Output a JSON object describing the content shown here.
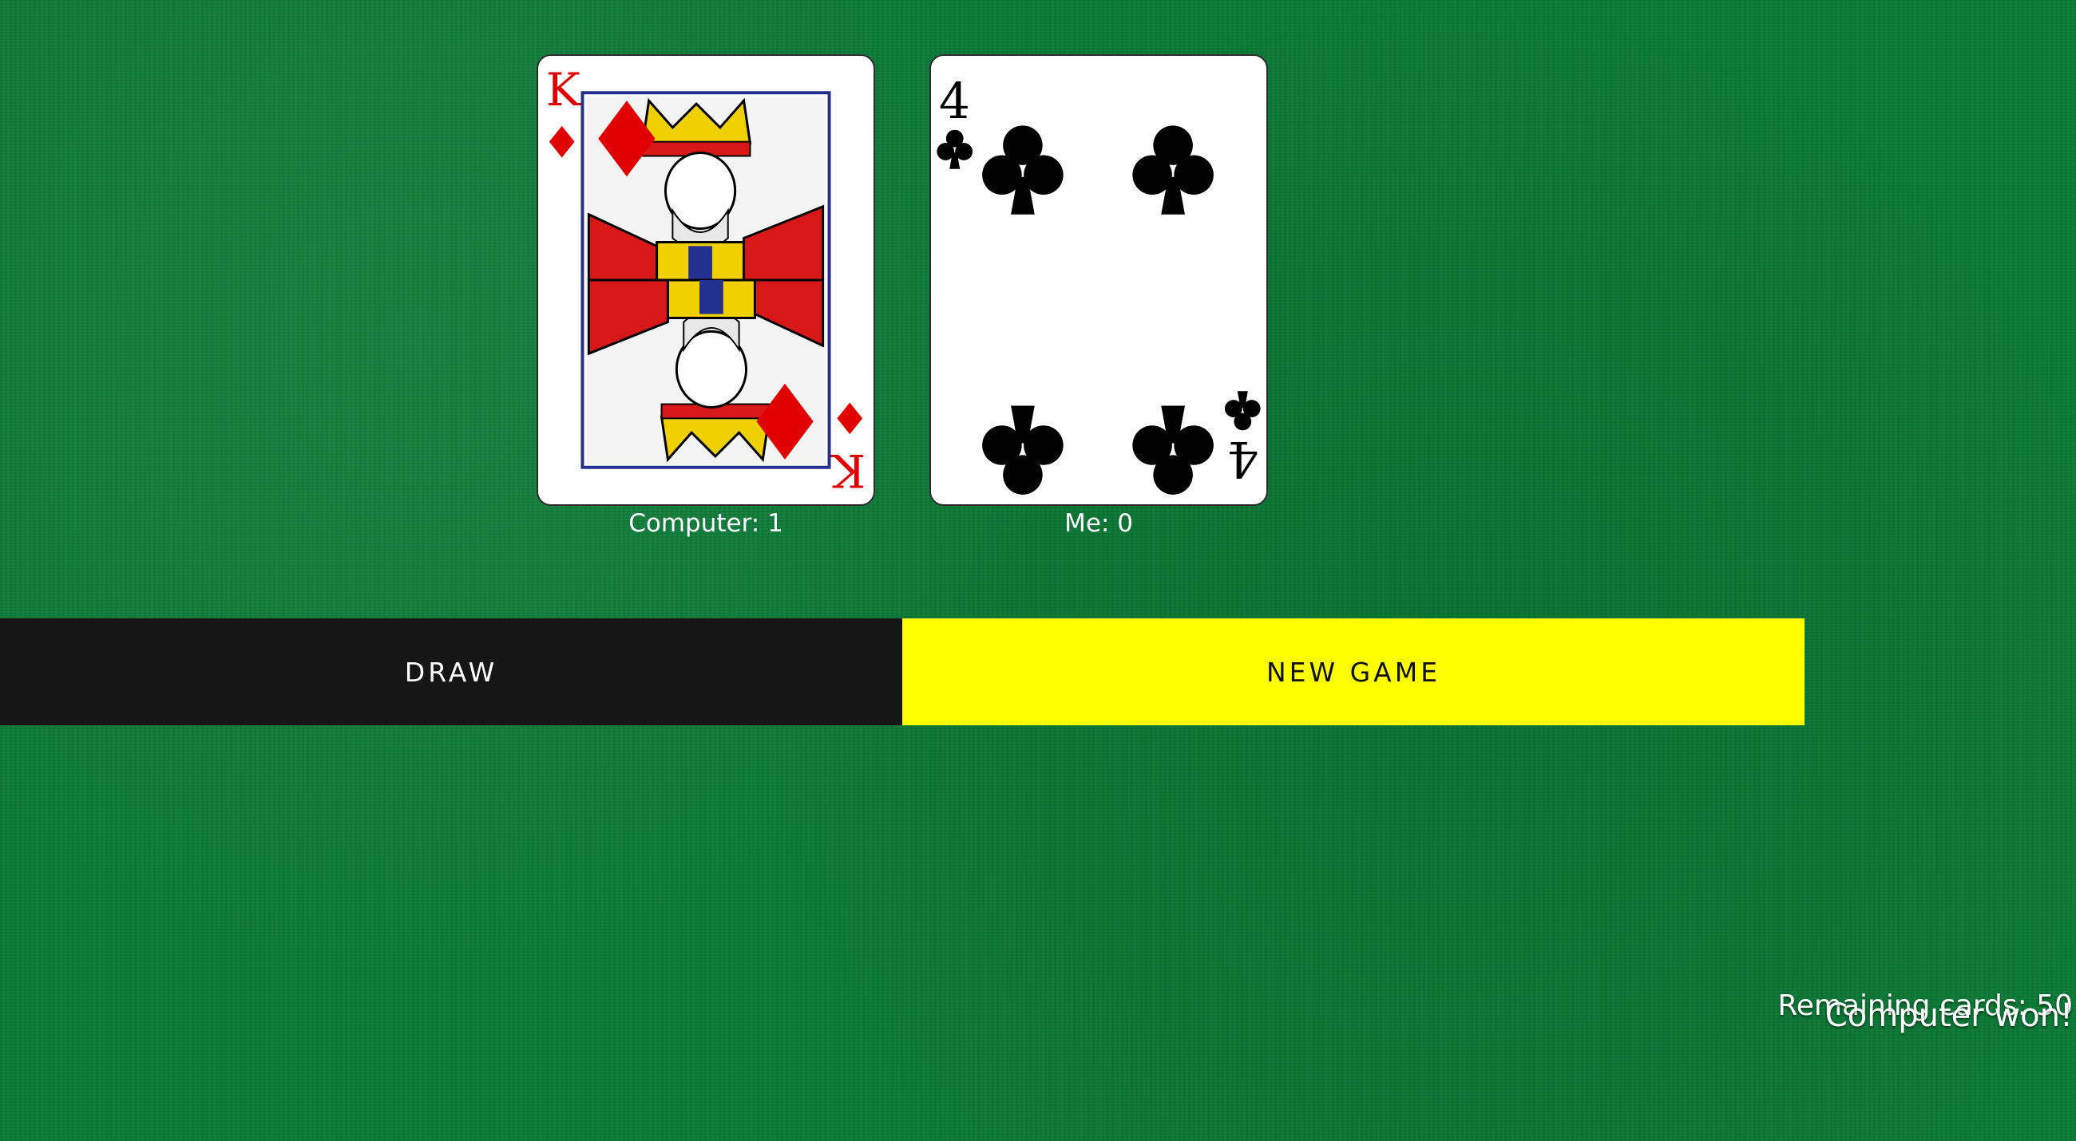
{
  "computer": {
    "label": "Computer: 1",
    "card": {
      "rank": "K",
      "suit": "diamonds",
      "color": "#e00000"
    }
  },
  "player": {
    "label": "Me: 0",
    "card": {
      "rank": "4",
      "suit": "clubs",
      "color": "#000000"
    }
  },
  "buttons": {
    "draw_label": "DRAW",
    "new_game_label": "NEW GAME"
  },
  "status": {
    "remaining": "Remaining cards: 50",
    "result": "Computer won!"
  },
  "colors": {
    "table": "#0a7a36",
    "draw_button": "#161616",
    "new_game_button": "#ffff00"
  }
}
